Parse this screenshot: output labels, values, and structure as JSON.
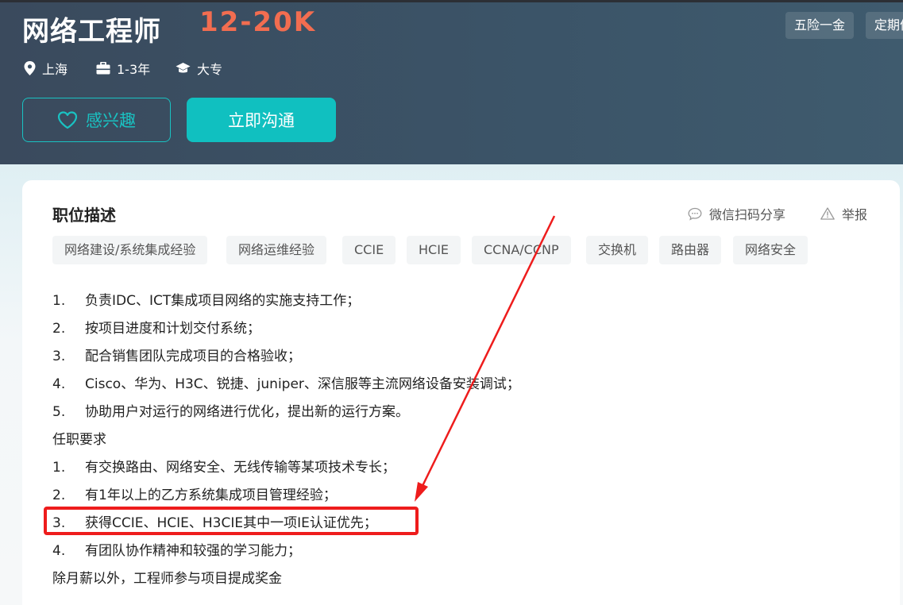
{
  "header": {
    "title": "网络工程师",
    "salary": "12-20K",
    "benefits": [
      "五险一金",
      "定期体检"
    ],
    "meta": {
      "location": "上海",
      "experience": "1-3年",
      "education": "大专"
    },
    "interest_button": "感兴趣",
    "chat_button": "立即沟通"
  },
  "section": {
    "title": "职位描述",
    "share_label": "微信扫码分享",
    "report_label": "举报",
    "tags": [
      "网络建设/系统集成经验",
      "网络运维经验",
      "CCIE",
      "HCIE",
      "CCNA/CCNP",
      "交换机",
      "路由器",
      "网络安全"
    ]
  },
  "description": {
    "duties": [
      {
        "num": "1.",
        "text": "负责IDC、ICT集成项目网络的实施支持工作；"
      },
      {
        "num": "2.",
        "text": "按项目进度和计划交付系统；"
      },
      {
        "num": "3.",
        "text": "配合销售团队完成项目的合格验收；"
      },
      {
        "num": "4.",
        "text": "Cisco、华为、H3C、锐捷、juniper、深信服等主流网络设备安装调试；"
      },
      {
        "num": "5.",
        "text": "协助用户对运行的网络进行优化，提出新的运行方案。"
      }
    ],
    "requirements_heading": "任职要求",
    "requirements": [
      {
        "num": "1.",
        "text": "有交换路由、网络安全、无线传输等某项技术专长；"
      },
      {
        "num": "2.",
        "text": "有1年以上的乙方系统集成项目管理经验；"
      },
      {
        "num": "3.",
        "text": "获得CCIE、HCIE、H3CIE其中一项IE认证优先；"
      },
      {
        "num": "4.",
        "text": "有团队协作精神和较强的学习能力；"
      }
    ],
    "footer_note": "除月薪以外，工程师参与项目提成奖金"
  },
  "annotation": {
    "color": "#ee1c1c"
  }
}
